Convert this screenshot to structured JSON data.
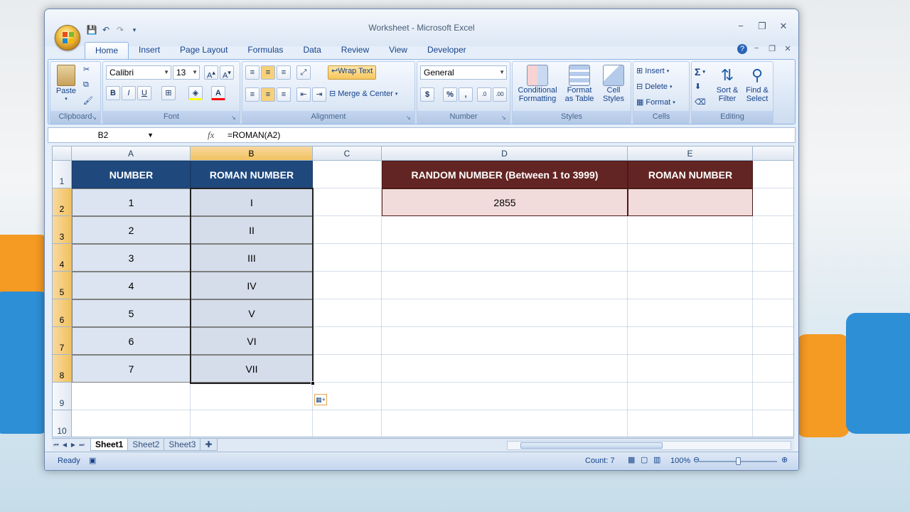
{
  "window": {
    "title": "Worksheet - Microsoft Excel",
    "minimize": "−",
    "restore": "❐",
    "close": "✕"
  },
  "ribbon_tabs": [
    "Home",
    "Insert",
    "Page Layout",
    "Formulas",
    "Data",
    "Review",
    "View",
    "Developer"
  ],
  "clipboard": {
    "label": "Clipboard",
    "paste": "Paste"
  },
  "font": {
    "label": "Font",
    "name": "Calibri",
    "size": "13",
    "bold": "B",
    "italic": "I",
    "underline": "U"
  },
  "alignment": {
    "label": "Alignment",
    "wrap_text": "Wrap Text",
    "merge_center": "Merge & Center"
  },
  "number": {
    "label": "Number",
    "format": "General",
    "currency": "$",
    "percent": "%",
    "comma": ","
  },
  "styles": {
    "label": "Styles",
    "conditional": "Conditional Formatting",
    "conditional_1": "Conditional",
    "conditional_2": "Formatting",
    "table_1": "Format",
    "table_2": "as Table",
    "cell_1": "Cell",
    "cell_2": "Styles"
  },
  "cells": {
    "label": "Cells",
    "insert": "Insert",
    "delete": "Delete",
    "format": "Format"
  },
  "editing": {
    "label": "Editing",
    "sigma": "Σ",
    "sort_1": "Sort &",
    "sort_2": "Filter",
    "find_1": "Find &",
    "find_2": "Select"
  },
  "formula_bar": {
    "name_box": "B2",
    "fx": "fx",
    "formula": "=ROMAN(A2)"
  },
  "columns": [
    "A",
    "B",
    "C",
    "D",
    "E"
  ],
  "rows": [
    "1",
    "2",
    "3",
    "4",
    "5",
    "6",
    "7",
    "8",
    "9",
    "10"
  ],
  "sheet": {
    "a_header": "NUMBER",
    "b_header": "ROMAN NUMBER",
    "d_header": "RANDOM NUMBER (Between 1 to 3999)",
    "e_header": "ROMAN NUMBER",
    "numbers": [
      "1",
      "2",
      "3",
      "4",
      "5",
      "6",
      "7"
    ],
    "romans": [
      "I",
      "II",
      "III",
      "IV",
      "V",
      "VI",
      "VII"
    ],
    "d2": "2855",
    "e2": ""
  },
  "sheet_tabs": [
    "Sheet1",
    "Sheet2",
    "Sheet3"
  ],
  "status": {
    "ready": "Ready",
    "count": "Count: 7",
    "zoom": "100%"
  },
  "colors": {
    "header_blue": "#1f497d",
    "header_red": "#632523",
    "selected_header": "#f1c15f"
  }
}
